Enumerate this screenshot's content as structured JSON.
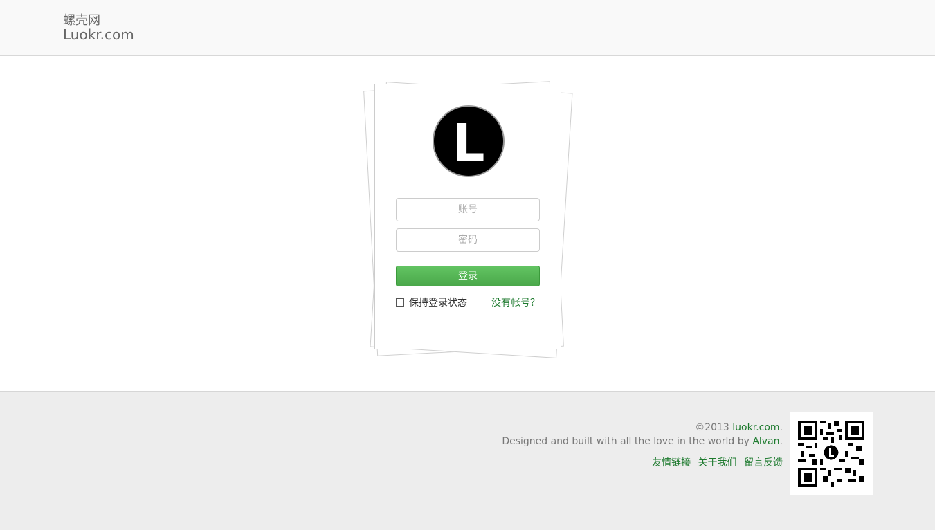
{
  "header": {
    "brand_cn": "螺壳网",
    "brand_en": "Luokr.com"
  },
  "login": {
    "avatar_letter": "L",
    "account_placeholder": "账号",
    "password_placeholder": "密码",
    "submit_label": "登录",
    "remember_label": "保持登录状态",
    "no_account_link": "没有帐号？"
  },
  "footer": {
    "copyright_prefix": "©2013 ",
    "site_link": "luokr.com",
    "period1": ".",
    "designed_text": "Designed and built with all the love in the world by ",
    "author_link": "Alvan",
    "period2": ".",
    "links": [
      "友情链接",
      "关于我们",
      "留言反馈"
    ]
  },
  "icons": {
    "avatar": "logo-letter-l-icon",
    "qr": "qr-code-icon"
  },
  "colors": {
    "accent_green": "#1d7a2e",
    "button_green": "#4aa84a",
    "footer_bg": "#ededed"
  }
}
